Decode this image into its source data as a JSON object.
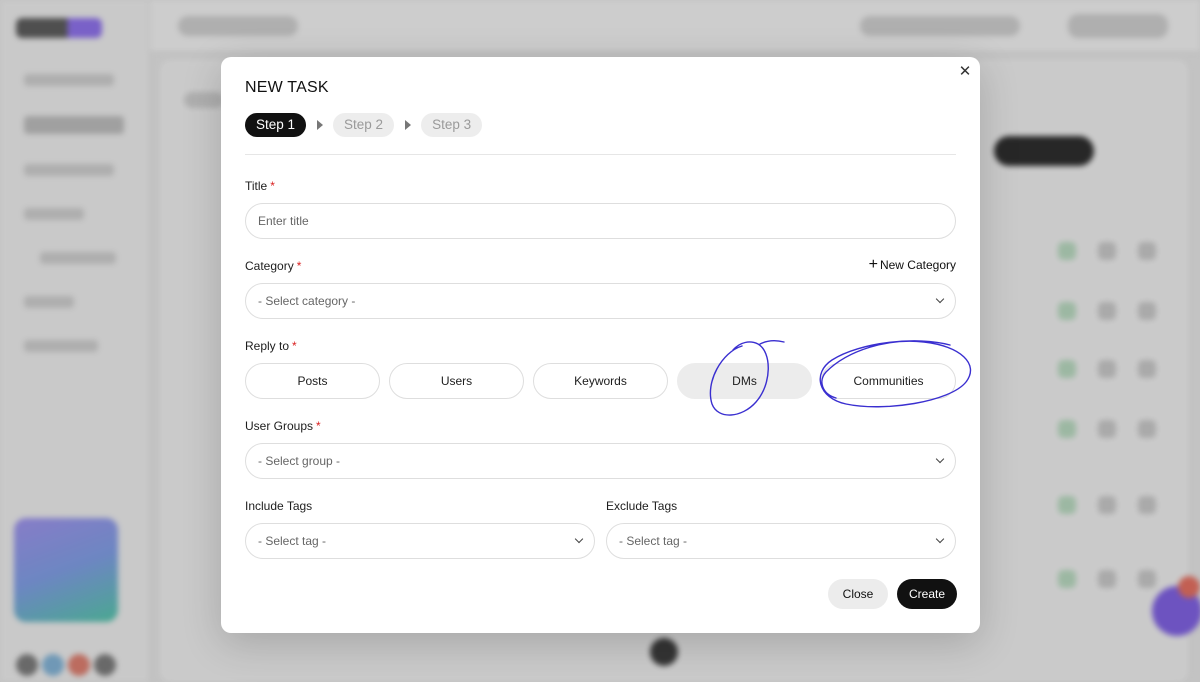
{
  "modal": {
    "title": "NEW TASK",
    "close_icon": "close-icon",
    "steps": [
      {
        "label": "Step 1",
        "active": true
      },
      {
        "label": "Step 2",
        "active": false
      },
      {
        "label": "Step 3",
        "active": false
      }
    ],
    "title_field": {
      "label": "Title",
      "required_mark": "*",
      "placeholder": "Enter title"
    },
    "category_field": {
      "label": "Category",
      "required_mark": "*",
      "placeholder": "- Select category -",
      "new_category_label": "New Category"
    },
    "reply_to": {
      "label": "Reply to",
      "required_mark": "*",
      "options": [
        "Posts",
        "Users",
        "Keywords",
        "DMs",
        "Communities"
      ],
      "selected": "DMs"
    },
    "user_groups_field": {
      "label": "User Groups",
      "required_mark": "*",
      "placeholder": "- Select group -"
    },
    "include_tags_field": {
      "label": "Include Tags",
      "placeholder": "- Select tag -"
    },
    "exclude_tags_field": {
      "label": "Exclude Tags",
      "placeholder": "- Select tag -"
    },
    "buttons": {
      "close": "Close",
      "create": "Create"
    }
  },
  "colors": {
    "primary": "#111111",
    "required": "#d92020",
    "annotation_ink": "#3a2fd0"
  }
}
